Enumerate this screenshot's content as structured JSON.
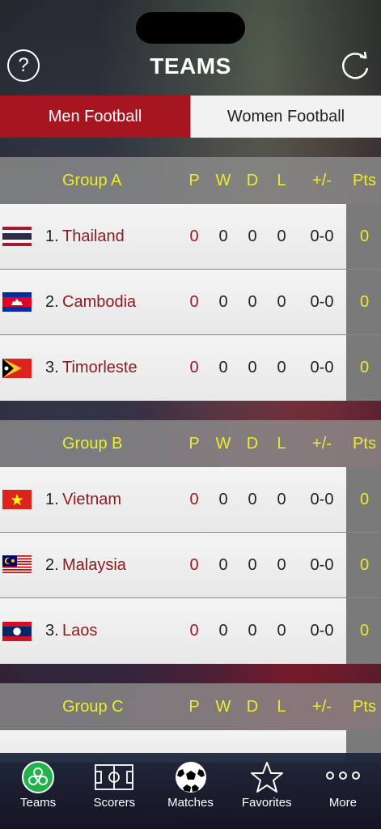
{
  "header": {
    "title": "TEAMS",
    "help_label": "?"
  },
  "tabs": [
    {
      "label": "Men Football",
      "active": true
    },
    {
      "label": "Women Football",
      "active": false
    }
  ],
  "columns": {
    "p": "P",
    "w": "W",
    "d": "D",
    "l": "L",
    "gd": "+/-",
    "pts": "Pts"
  },
  "groups": [
    {
      "name": "Group A",
      "teams": [
        {
          "rank": "1.",
          "name": "Thailand",
          "flag": "thailand-flag",
          "p": "0",
          "w": "0",
          "d": "0",
          "l": "0",
          "gd": "0-0",
          "pts": "0"
        },
        {
          "rank": "2.",
          "name": "Cambodia",
          "flag": "cambodia-flag",
          "p": "0",
          "w": "0",
          "d": "0",
          "l": "0",
          "gd": "0-0",
          "pts": "0"
        },
        {
          "rank": "3.",
          "name": "Timorleste",
          "flag": "timorleste-flag",
          "p": "0",
          "w": "0",
          "d": "0",
          "l": "0",
          "gd": "0-0",
          "pts": "0"
        }
      ]
    },
    {
      "name": "Group B",
      "teams": [
        {
          "rank": "1.",
          "name": "Vietnam",
          "flag": "vietnam-flag",
          "p": "0",
          "w": "0",
          "d": "0",
          "l": "0",
          "gd": "0-0",
          "pts": "0"
        },
        {
          "rank": "2.",
          "name": "Malaysia",
          "flag": "malaysia-flag",
          "p": "0",
          "w": "0",
          "d": "0",
          "l": "0",
          "gd": "0-0",
          "pts": "0"
        },
        {
          "rank": "3.",
          "name": "Laos",
          "flag": "laos-flag",
          "p": "0",
          "w": "0",
          "d": "0",
          "l": "0",
          "gd": "0-0",
          "pts": "0"
        }
      ]
    },
    {
      "name": "Group C",
      "teams": []
    }
  ],
  "tabbar": [
    {
      "label": "Teams",
      "icon": "teams-icon",
      "active": true
    },
    {
      "label": "Scorers",
      "icon": "pitch-icon",
      "active": false
    },
    {
      "label": "Matches",
      "icon": "soccer-ball-icon",
      "active": false
    },
    {
      "label": "Favorites",
      "icon": "star-icon",
      "active": false
    },
    {
      "label": "More",
      "icon": "more-dots-icon",
      "active": false
    }
  ],
  "colors": {
    "accent": "#a51620",
    "highlight": "#ecec2c",
    "active_tab_icon": "#1fb34a"
  }
}
